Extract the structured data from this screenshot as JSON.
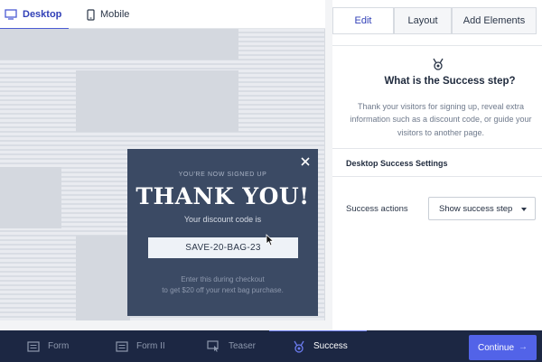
{
  "device_tabs": {
    "desktop": "Desktop",
    "mobile": "Mobile"
  },
  "popup": {
    "kicker": "YOU'RE NOW SIGNED UP",
    "headline": "THANK YOU!",
    "sub": "Your discount code is",
    "code": "SAVE-20-BAG-23",
    "note_line1": "Enter this during checkout",
    "note_line2": "to get $20 off your next bag purchase."
  },
  "panel": {
    "tabs": {
      "edit": "Edit",
      "layout": "Layout",
      "add": "Add Elements"
    },
    "title": "What is the Success step?",
    "description": "Thank your visitors for signing up, reveal extra information such as a discount code, or guide your visitors to another page.",
    "section": "Desktop Success Settings",
    "field_label": "Success actions",
    "select_value": "Show success step"
  },
  "steps": {
    "form": "Form",
    "form2": "Form II",
    "teaser": "Teaser",
    "success": "Success"
  },
  "continue_label": "Continue",
  "colors": {
    "accent": "#5263e8",
    "bottom_bar": "#1c2743",
    "popup_bg": "#3b4a64"
  }
}
